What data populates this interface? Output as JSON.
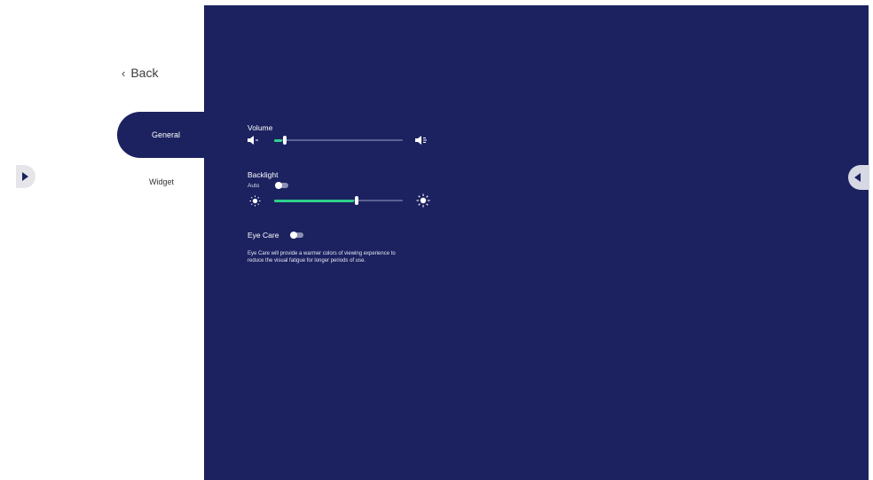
{
  "nav": {
    "back_label": "Back",
    "tabs": [
      {
        "label": "General",
        "selected": true
      },
      {
        "label": "Widget",
        "selected": false
      }
    ]
  },
  "settings": {
    "volume": {
      "label": "Volume",
      "level_percent": 8
    },
    "backlight": {
      "label": "Backlight",
      "auto_label": "Auto",
      "auto_enabled": false,
      "level_percent": 64
    },
    "eye_care": {
      "label": "Eye Care",
      "enabled": false,
      "description_lines": [
        "Eye Care will provide a warmer colors of viewing experience to",
        "reduce the visual fatigue for longer periods of use."
      ]
    }
  },
  "colors": {
    "panel_background": "#1c2260",
    "accent_green": "#2fd08a",
    "track": "#5b6193"
  }
}
